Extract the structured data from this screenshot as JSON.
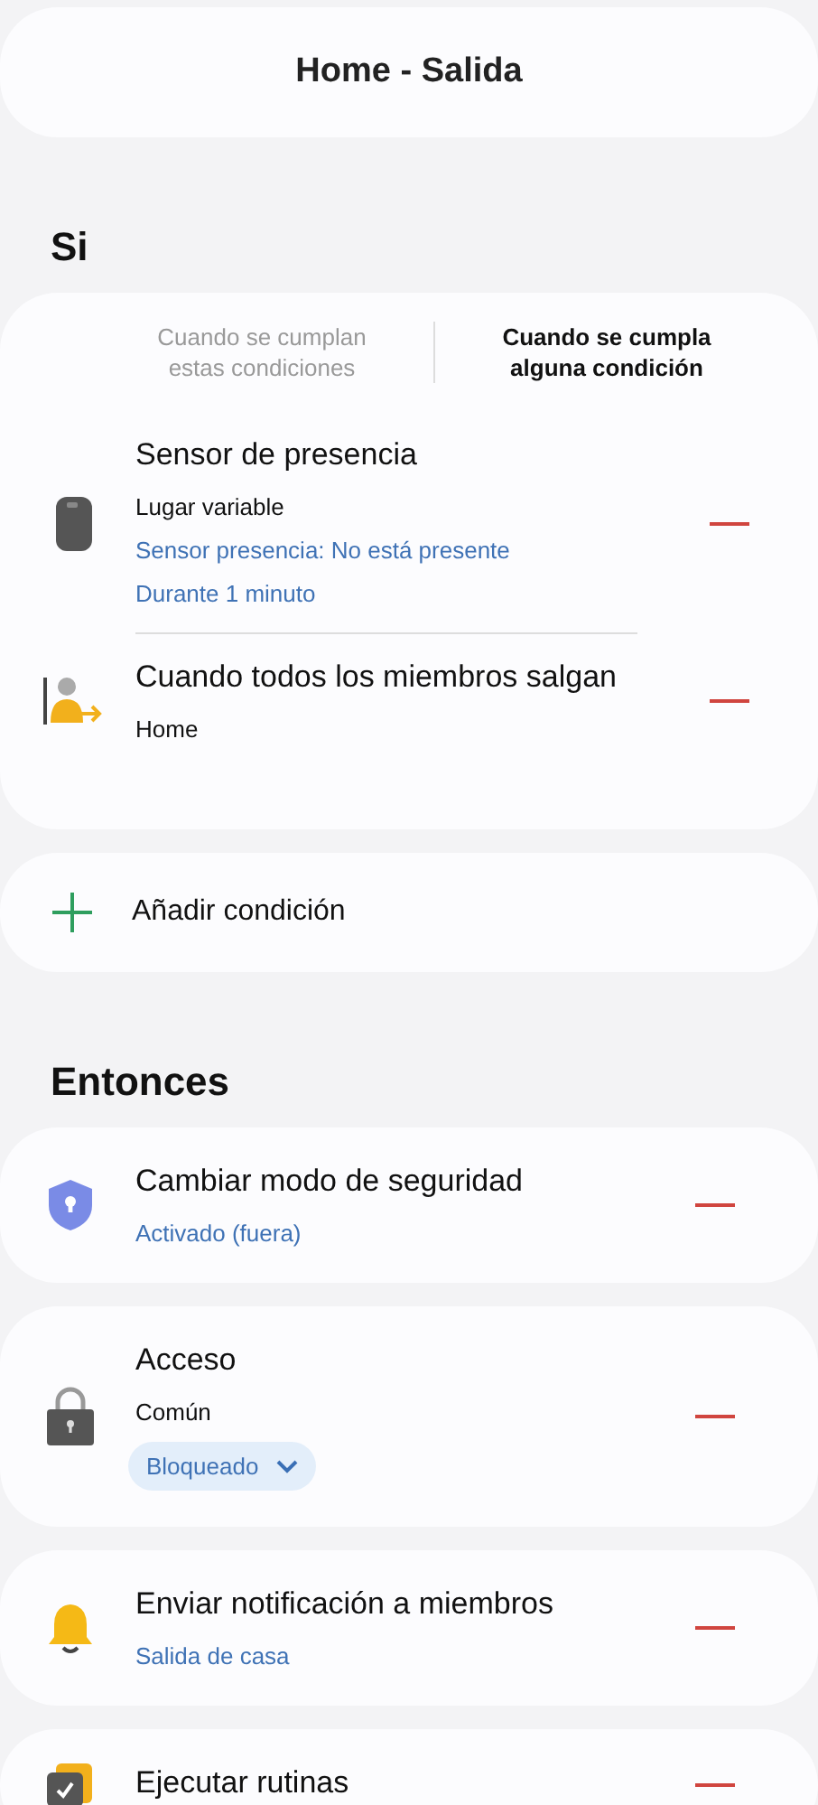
{
  "header": {
    "title": "Home - Salida"
  },
  "if_section": {
    "title": "Si",
    "tabs": [
      {
        "label": "Cuando se cumplan estas condiciones",
        "selected": false
      },
      {
        "label": "Cuando se cumpla alguna condición",
        "selected": true
      }
    ],
    "conditions": [
      {
        "kind": "sensor",
        "title": "Sensor de presencia",
        "lines": [
          {
            "kind": "plain",
            "text": "Lugar variable"
          },
          {
            "kind": "link",
            "text": "Sensor presencia: No está presente"
          },
          {
            "kind": "link",
            "text": "Durante 1 minuto"
          }
        ]
      },
      {
        "kind": "members",
        "title": "Cuando todos los miembros salgan",
        "lines": [
          {
            "kind": "plain",
            "text": "Home"
          }
        ]
      }
    ]
  },
  "add_condition": {
    "label": "Añadir condición"
  },
  "then_section": {
    "title": "Entonces",
    "actions": [
      {
        "kind": "security",
        "title": "Cambiar modo de seguridad",
        "lines": [
          {
            "kind": "link",
            "text": "Activado (fuera)"
          }
        ]
      },
      {
        "kind": "lock",
        "title": "Acceso",
        "lines": [
          {
            "kind": "plain",
            "text": "Común"
          },
          {
            "kind": "dropdown",
            "text": "Bloqueado"
          }
        ]
      },
      {
        "kind": "bell",
        "title": "Enviar notificación a miembros",
        "lines": [
          {
            "kind": "link",
            "text": "Salida de casa"
          }
        ]
      },
      {
        "kind": "routine",
        "title": "Ejecutar rutinas"
      }
    ]
  }
}
